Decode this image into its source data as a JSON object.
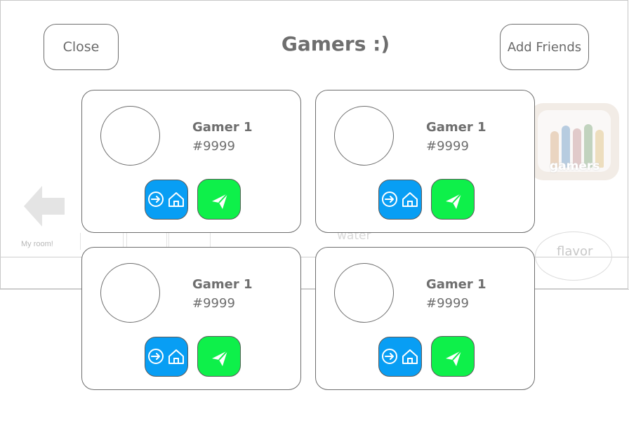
{
  "header": {
    "title": "Gamers :)",
    "close_label": "Close",
    "add_friends_label": "Add Friends"
  },
  "background": {
    "my_room_label": "My room!",
    "gamers_label": "gamers",
    "water_label": "water",
    "flavor_label": "flavor"
  },
  "friends": [
    {
      "name": "Gamer 1",
      "tag": "#9999"
    },
    {
      "name": "Gamer 1",
      "tag": "#9999"
    },
    {
      "name": "Gamer 1",
      "tag": "#9999"
    },
    {
      "name": "Gamer 1",
      "tag": "#9999"
    }
  ],
  "icons": {
    "visit": "enter-home-icon",
    "message": "paper-plane-icon",
    "back": "back-arrow-icon"
  },
  "colors": {
    "visit_button": "#089ef4",
    "message_button": "#0ef04a",
    "text": "#6e6e6e"
  }
}
